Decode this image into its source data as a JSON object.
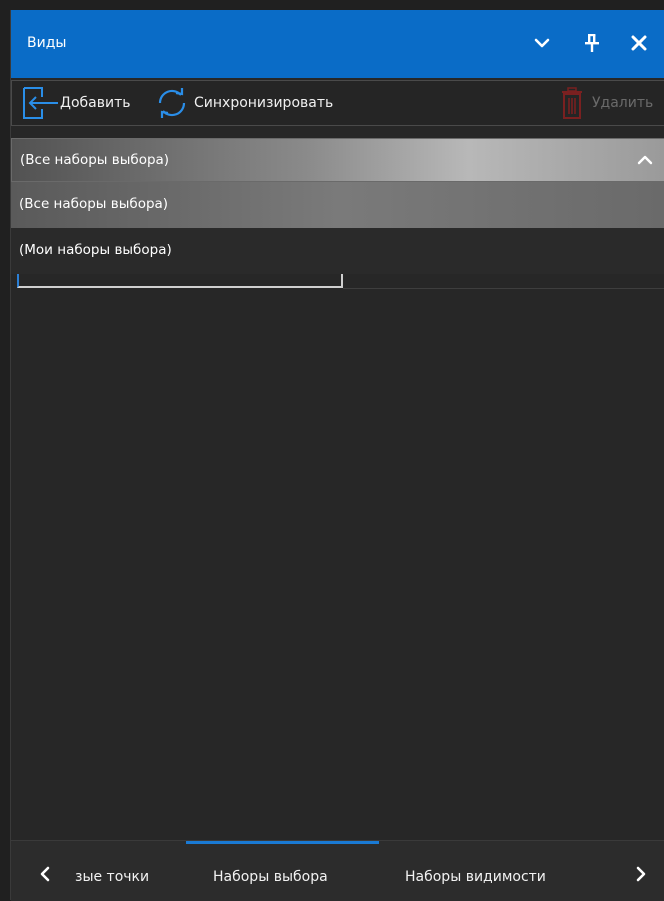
{
  "panel": {
    "title": "Виды",
    "colors": {
      "titlebar": "#0a6cc7",
      "accent": "#1a7ad4"
    }
  },
  "titlebar_icons": [
    "chevron-down-icon",
    "pin-icon",
    "close-icon"
  ],
  "toolbar": {
    "add_label": "Добавить",
    "sync_label": "Синхронизировать",
    "delete_label": "Удалить"
  },
  "dropdown": {
    "selected": "(Все наборы выбора)",
    "options": [
      {
        "label": "(Все наборы выбора)",
        "selected": true
      },
      {
        "label": "(Мои наборы выбора)",
        "selected": false
      }
    ]
  },
  "tabs": {
    "items": [
      {
        "label": "зые точки",
        "active": false
      },
      {
        "label": "Наборы выбора",
        "active": true
      },
      {
        "label": "Наборы видимости",
        "active": false
      }
    ]
  }
}
